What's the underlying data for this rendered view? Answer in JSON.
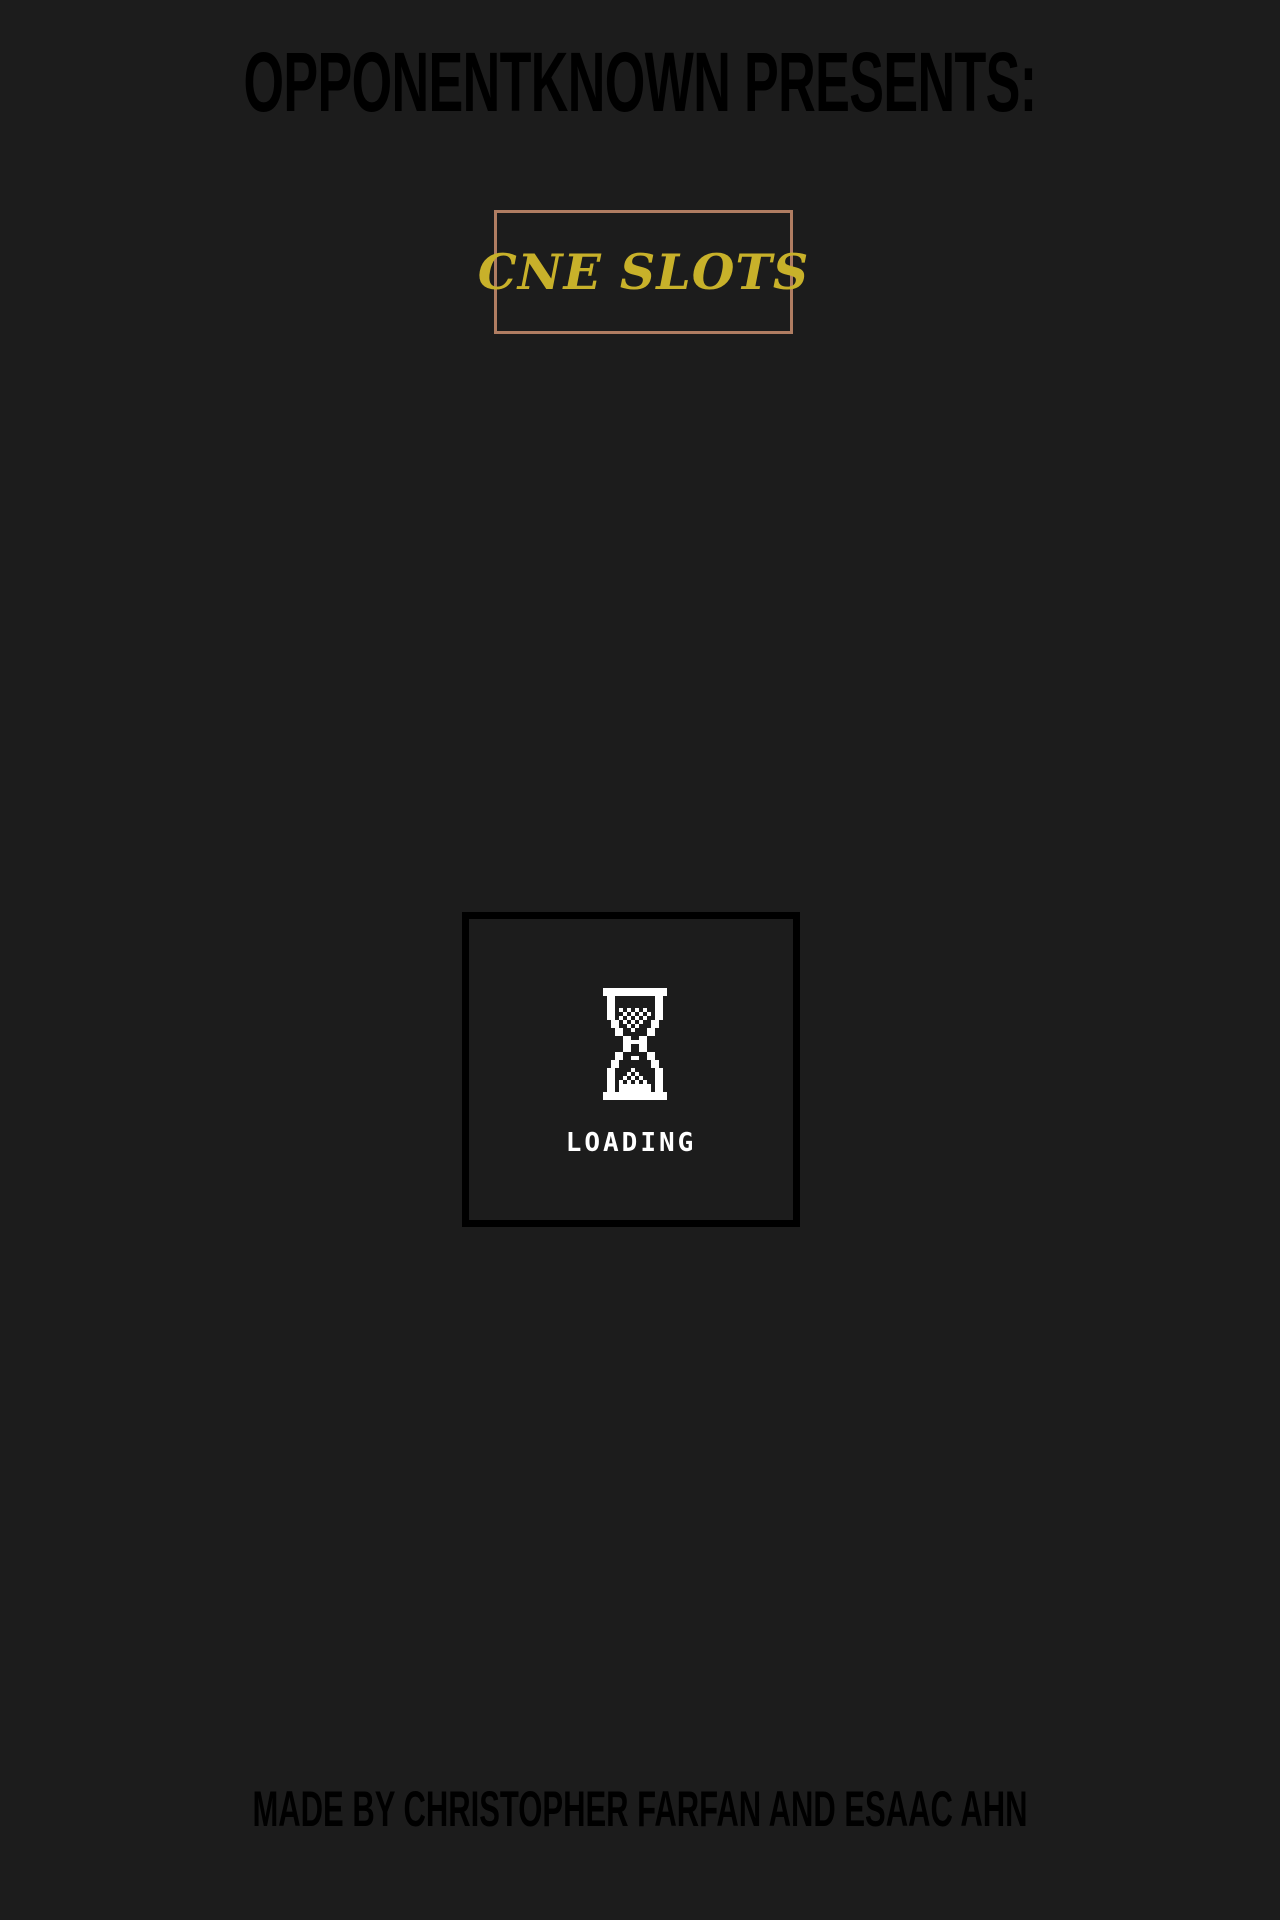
{
  "header": {
    "title": "OPPONENTKNOWN PRESENTS:"
  },
  "game": {
    "title": "CNE SLOTS"
  },
  "loader": {
    "icon": "hourglass-icon",
    "label": "LOADING"
  },
  "footer": {
    "credits": "MADE BY CHRISTOPHER FARFAN AND ESAAC AHN"
  },
  "colors": {
    "background": "#1c1c1c",
    "headline": "#000000",
    "game_title": "#c8b12a",
    "game_title_border": "#b07d62",
    "loader_border": "#000000",
    "loader_text": "#ffffff"
  }
}
